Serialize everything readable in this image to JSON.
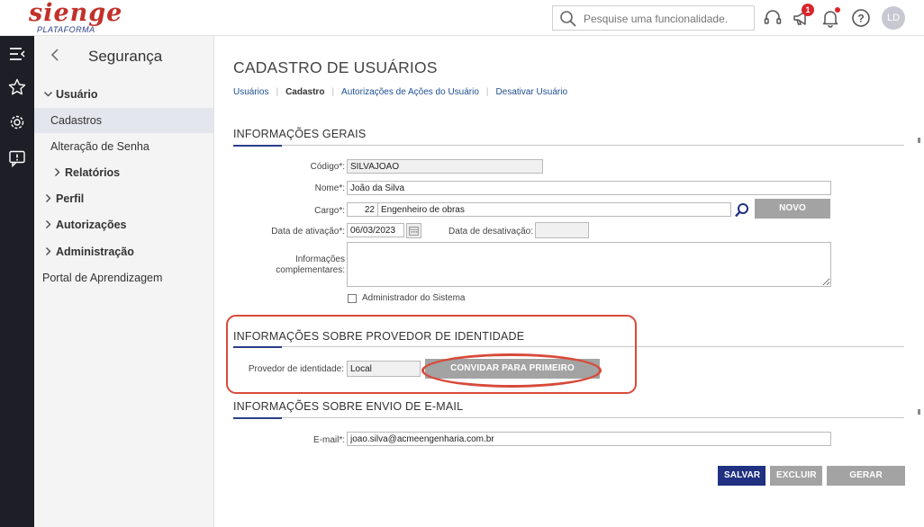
{
  "header": {
    "logo_text": "sienge",
    "logo_sub": "PLATAFORMA",
    "search_placeholder": "Pesquise uma funcionalidade.",
    "notification_count": "1",
    "user_initials": "LD"
  },
  "sidebar": {
    "title": "Segurança",
    "items": [
      {
        "label": "Usuário",
        "expanded": true
      },
      {
        "label": "Cadastros",
        "active": true
      },
      {
        "label": "Alteração de Senha"
      },
      {
        "label": "Relatórios"
      },
      {
        "label": "Perfil"
      },
      {
        "label": "Autorizações"
      },
      {
        "label": "Administração"
      },
      {
        "label": "Portal de Aprendizagem"
      }
    ]
  },
  "page": {
    "title": "CADASTRO DE USUÁRIOS",
    "breadcrumbs": [
      "Usuários",
      "Cadastro",
      "Autorizações de Ações do Usuário",
      "Desativar Usuário"
    ],
    "active_crumb": "Cadastro"
  },
  "general": {
    "section_title": "INFORMAÇÕES GERAIS",
    "codigo_label": "Código*:",
    "codigo_value": "SILVAJOAO",
    "nome_label": "Nome*:",
    "nome_value": "João da Silva",
    "cargo_label": "Cargo*:",
    "cargo_code": "22",
    "cargo_name": "Engenheiro de obras",
    "novo_cargo_label": "NOVO CARGO",
    "ativacao_label": "Data de ativação*:",
    "ativacao_value": "06/03/2023",
    "desativacao_label": "Data de desativação:",
    "desativacao_value": "",
    "info_label_1": "Informações",
    "info_label_2": "complementares:",
    "info_value": "",
    "admin_label": "Administrador do Sistema",
    "admin_checked": false
  },
  "identity": {
    "section_title": "INFORMAÇÕES SOBRE PROVEDOR DE IDENTIDADE",
    "provider_label": "Provedor de identidade:",
    "provider_value": "Local",
    "invite_label": "CONVIDAR PARA PRIMEIRO ACESSO"
  },
  "email": {
    "section_title": "INFORMAÇÕES SOBRE ENVIO DE E-MAIL",
    "email_label": "E-mail*:",
    "email_value": "joao.silva@acmeengenharia.com.br"
  },
  "actions": {
    "save": "SALVAR",
    "delete": "EXCLUIR",
    "generate": "GERAR SENHA"
  },
  "colors": {
    "brand": "#c2312a",
    "primary": "#1f3180",
    "highlight": "#d84a3a",
    "rail": "#1e1e26"
  }
}
